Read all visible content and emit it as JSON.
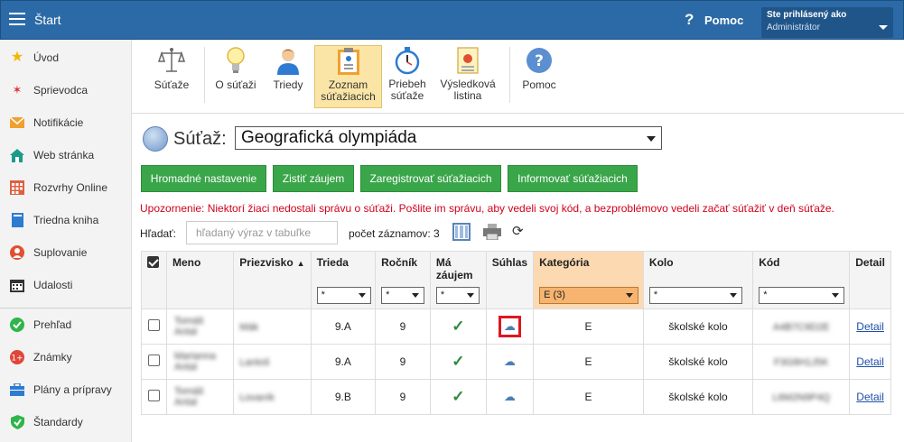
{
  "header": {
    "title": "Štart",
    "help_label": "Pomoc",
    "user_line1": "Ste prihlásený ako",
    "user_line2": "Administrátor"
  },
  "sidebar": {
    "items": [
      {
        "label": "Úvod",
        "icon": "star-icon"
      },
      {
        "label": "Sprievodca",
        "icon": "wand-icon"
      },
      {
        "label": "Notifikácie",
        "icon": "envelope-icon"
      },
      {
        "label": "Web stránka",
        "icon": "house-icon"
      },
      {
        "label": "Rozvrhy Online",
        "icon": "calendar-grid-icon"
      },
      {
        "label": "Triedna kniha",
        "icon": "book-icon"
      },
      {
        "label": "Suplovanie",
        "icon": "person-icon"
      },
      {
        "label": "Udalosti",
        "icon": "calendar-icon"
      },
      {
        "label": "Prehľad",
        "icon": "check-circle-icon"
      },
      {
        "label": "Známky",
        "icon": "grade-icon"
      },
      {
        "label": "Plány a prípravy",
        "icon": "briefcase-icon"
      },
      {
        "label": "Štandardy",
        "icon": "shield-check-icon"
      }
    ]
  },
  "toolbar": {
    "items": [
      {
        "label": "Súťaže",
        "icon": "scales-icon"
      },
      {
        "label": "O súťaži",
        "icon": "lightbulb-icon"
      },
      {
        "label": "Triedy",
        "icon": "student-icon"
      },
      {
        "label": "Zoznam súťažiacich",
        "icon": "clipboard-icon"
      },
      {
        "label": "Priebeh súťaže",
        "icon": "stopwatch-icon"
      },
      {
        "label": "Výsledková listina",
        "icon": "certificate-icon"
      },
      {
        "label": "Pomoc",
        "icon": "help-icon"
      }
    ]
  },
  "competition": {
    "label": "Súťaž:",
    "selected": "Geografická olympiáda"
  },
  "actions": {
    "bulk": "Hromadné nastavenie",
    "interest": "Zistiť záujem",
    "register": "Zaregistrovať súťažiacich",
    "inform": "Informovať súťažiacich"
  },
  "warning": "Upozornenie: Niektorí žiaci nedostali správu o súťaži. Pošlite im správu, aby vedeli svoj kód, a bezproblémovo vedeli začať súťažiť v deň súťaže.",
  "search": {
    "label": "Hľadať:",
    "placeholder": "hľadaný výraz v tabuľke",
    "count_label": "počet záznamov:",
    "count": "3"
  },
  "table": {
    "headers": {
      "meno": "Meno",
      "priezvisko": "Priezvisko",
      "trieda": "Trieda",
      "rocnik": "Ročník",
      "ma_zaujem": "Má záujem",
      "suhlas": "Súhlas",
      "kategoria": "Kategória",
      "kolo": "Kolo",
      "kod": "Kód",
      "detail": "Detail"
    },
    "filters": {
      "trieda": "*",
      "rocnik": "*",
      "ma_zaujem": "*",
      "kategoria": "E (3)",
      "kolo": "*",
      "kod": "*"
    },
    "rows": [
      {
        "meno": "Tomáš Antal",
        "priezvisko": "Mák",
        "trieda": "9.A",
        "rocnik": "9",
        "kategoria": "E",
        "kolo": "školské kolo",
        "kod": "A4B7C9D2E",
        "detail": "Detail"
      },
      {
        "meno": "Marianna Antal",
        "priezvisko": "Lantoš",
        "trieda": "9.A",
        "rocnik": "9",
        "kategoria": "E",
        "kolo": "školské kolo",
        "kod": "F3G8H1J5K",
        "detail": "Detail"
      },
      {
        "meno": "Tomáš Antal",
        "priezvisko": "Lovaník",
        "trieda": "9.B",
        "rocnik": "9",
        "kategoria": "E",
        "kolo": "školské kolo",
        "kod": "L6M2N9P4Q",
        "detail": "Detail"
      }
    ]
  },
  "colors": {
    "header_bg": "#2b6aa6",
    "button_green": "#3aa64a",
    "warning_red": "#d0021b",
    "filter_highlight": "#f6b470"
  }
}
